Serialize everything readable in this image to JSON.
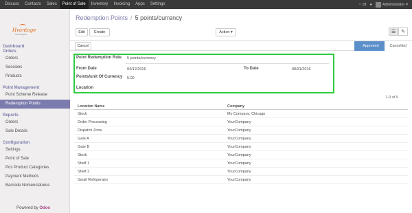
{
  "topbar": {
    "menu": [
      "Discuss",
      "Contacts",
      "Sales",
      "Point of Sale",
      "Inventory",
      "Invoicing",
      "Apps",
      "Settings"
    ],
    "active_menu": "Point of Sale",
    "notifications": "18",
    "user": "Administrator"
  },
  "logo": {
    "brand": "Hvantage",
    "sub": "technologies"
  },
  "sidebar": {
    "sections": [
      {
        "label": "Dashboard"
      },
      {
        "label": "Orders",
        "items": [
          "Orders",
          "Sessions",
          "Products"
        ]
      },
      {
        "label": "Point Management",
        "items": [
          "Point Scheme Release",
          "Redemption Points"
        ]
      },
      {
        "label": "Reports",
        "items": [
          "Orders",
          "Sale Details"
        ]
      },
      {
        "label": "Configuration",
        "items": [
          "Settings",
          "Point of Sale",
          "Pos Product Categories",
          "Payment Methods",
          "Barcode Nomenclatures"
        ]
      }
    ],
    "active_item": "Redemption Points",
    "powered_prefix": "Powered by",
    "powered_brand": "Odoo"
  },
  "breadcrumb": {
    "parent": "Redemption Points",
    "separator": "/",
    "current": "5 points/currency"
  },
  "toolbar": {
    "edit_label": "Edit",
    "create_label": "Create",
    "action_label": "Action ▾"
  },
  "statusbar": {
    "cancel_label": "Cancel",
    "stages": [
      "Approved",
      "Cancelled"
    ],
    "active_stage": "Approved"
  },
  "form": {
    "rule_label": "Point Redemption Rule",
    "rule_value": "5 points/currency",
    "from_label": "From Date",
    "from_value": "04/12/2016",
    "to_label": "To Date",
    "to_value": "08/31/2016",
    "ppc_label": "Points/unit Of Currency",
    "ppc_value": "5.00",
    "location_label": "Location"
  },
  "pager": "1-9 of 9",
  "table": {
    "headers": [
      "Location Name",
      "Company"
    ],
    "rows": [
      [
        "Stock",
        "My Company, Chicago"
      ],
      [
        "Order Processing",
        "YourCompany"
      ],
      [
        "Dispatch Zone",
        "YourCompany"
      ],
      [
        "Gate A",
        "YourCompany"
      ],
      [
        "Gate B",
        "YourCompany"
      ],
      [
        "Stock",
        "YourCompany"
      ],
      [
        "Shelf 1",
        "YourCompany"
      ],
      [
        "Shelf 2",
        "YourCompany"
      ],
      [
        "Small Refrigerator",
        "YourCompany"
      ]
    ]
  },
  "colors": {
    "accent": "#7c7bad",
    "highlight_box": "#2ecc40",
    "stage_active": "#5b8fc9",
    "topbar": "#3a3a3a"
  }
}
